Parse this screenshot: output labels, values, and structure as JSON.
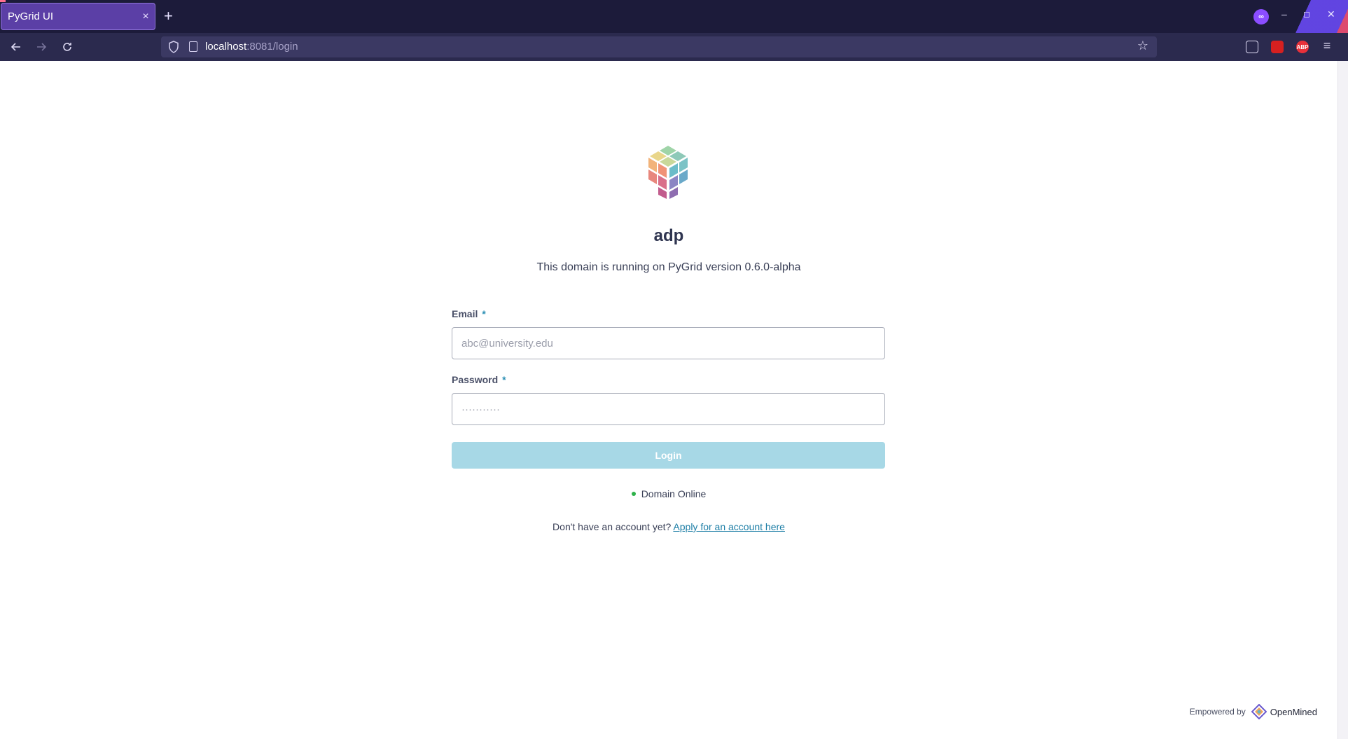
{
  "browser": {
    "tab_title": "PyGrid UI",
    "tab_close": "×",
    "new_tab": "+",
    "url_host": "localhost",
    "url_rest": ":8081/login",
    "window_controls": {
      "minimize": "–",
      "restore": "◻",
      "close": "✕"
    },
    "extensions": {
      "private": "∞",
      "adblock": "ABP"
    }
  },
  "login": {
    "domain_name": "adp",
    "subtitle": "This domain is running on PyGrid version 0.6.0-alpha",
    "email_label": "Email",
    "email_placeholder": "abc@university.edu",
    "password_label": "Password",
    "password_placeholder": "···········",
    "required_marker": "*",
    "login_button": "Login",
    "status_text": "Domain Online",
    "status_color": "#2eb24a",
    "no_account_text": "Don't have an account yet?",
    "apply_link": "Apply for an account here"
  },
  "footer": {
    "empowered_by": "Empowered by",
    "brand": "OpenMined"
  },
  "colors": {
    "accent": "#1d7ea6",
    "button_disabled": "#a7d8e6",
    "browser_bg": "#1c1b3a"
  }
}
